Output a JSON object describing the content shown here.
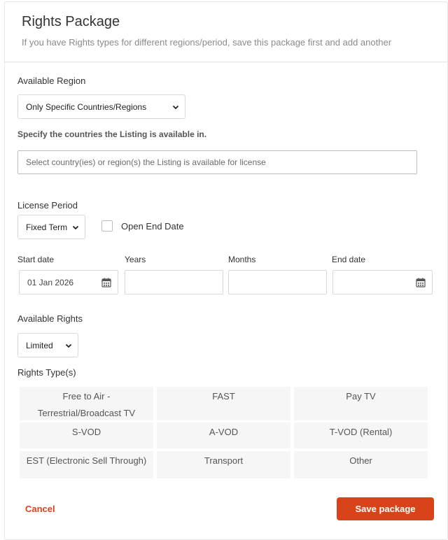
{
  "header": {
    "title": "Rights Package",
    "subtitle": "If you have Rights types for different regions/period, save this package first and add another"
  },
  "region": {
    "label": "Available Region",
    "selected": "Only Specific Countries/Regions",
    "countries_hint": "Specify the countries the Listing is available in.",
    "countries_placeholder": "Select country(ies) or region(s) the Listing is available for license"
  },
  "license": {
    "label": "License Period",
    "selected": "Fixed Term",
    "open_end_label": "Open End Date",
    "open_end_checked": false,
    "start_label": "Start date",
    "start_value": "01 Jan 2026",
    "years_label": "Years",
    "months_label": "Months",
    "end_label": "End date"
  },
  "rights": {
    "label": "Available Rights",
    "selected": "Limited",
    "types_label": "Rights Type(s)",
    "types": [
      [
        "Free to Air - Terrestrial/Broadcast TV",
        "FAST",
        "Pay TV"
      ],
      [
        "S-VOD",
        "A-VOD",
        "T-VOD (Rental)"
      ],
      [
        "EST (Electronic Sell Through)",
        "Transport",
        "Other"
      ]
    ]
  },
  "actions": {
    "cancel_label": "Cancel",
    "save_label": "Save package"
  },
  "colors": {
    "accent": "#d9431a",
    "cell_bg": "#f6f6f6"
  },
  "icons": {
    "select_arrow": "chevron-down-icon",
    "date_picker": "calendar-icon"
  }
}
